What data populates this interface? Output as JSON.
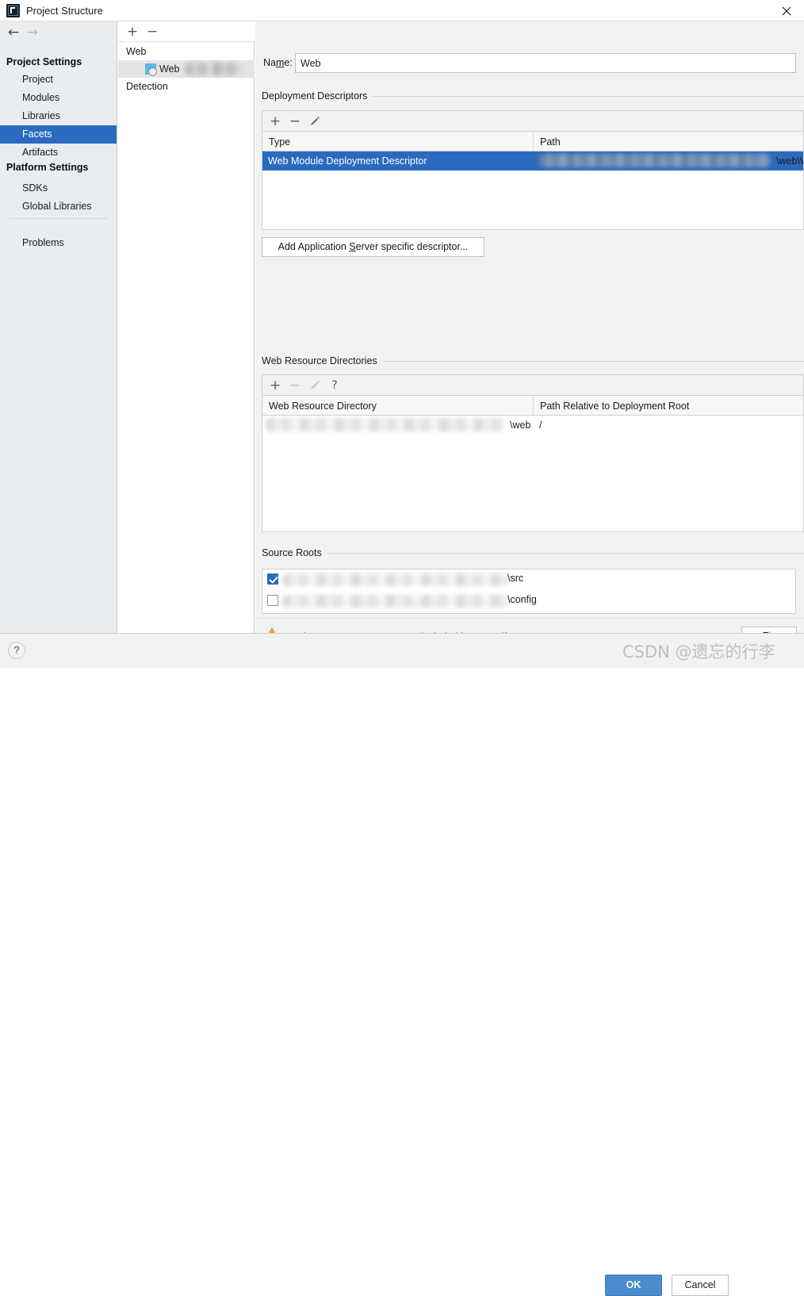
{
  "window": {
    "title": "Project Structure",
    "app_icon": "intellij-idea-icon",
    "close_icon": "close-icon"
  },
  "nav": {
    "back_icon": "arrow-left-icon",
    "forward_icon": "arrow-right-icon"
  },
  "sidebar": {
    "groups": [
      {
        "title": "Project Settings",
        "items": [
          {
            "label": "Project",
            "selected": false
          },
          {
            "label": "Modules",
            "selected": false
          },
          {
            "label": "Libraries",
            "selected": false
          },
          {
            "label": "Facets",
            "selected": true
          },
          {
            "label": "Artifacts",
            "selected": false
          }
        ]
      },
      {
        "title": "Platform Settings",
        "items": [
          {
            "label": "SDKs",
            "selected": false
          },
          {
            "label": "Global Libraries",
            "selected": false
          }
        ]
      }
    ],
    "problems_label": "Problems"
  },
  "facet_panel": {
    "toolbar": {
      "add": "+",
      "remove": "−"
    },
    "rows": [
      {
        "label": "Web",
        "indent": false,
        "icon": false,
        "selected": false,
        "redacted": false
      },
      {
        "label": "Web",
        "indent": true,
        "icon": true,
        "selected": true,
        "redacted": true
      },
      {
        "label": "Detection",
        "indent": false,
        "icon": false,
        "selected": false,
        "redacted": false
      }
    ]
  },
  "main": {
    "name_field": {
      "label": "Name:",
      "label_mnemonic": "m",
      "value": "Web",
      "placeholder": ""
    },
    "deployment_descriptors": {
      "title": "Deployment Descriptors",
      "toolbar": {
        "add": "+",
        "remove": "−",
        "edit": "pencil-icon"
      },
      "columns": [
        "Type",
        "Path"
      ],
      "rows": [
        {
          "type": "Web Module Deployment Descriptor",
          "path_redacted": true,
          "path_suffix": "\\web\\WE",
          "selected": true
        }
      ],
      "add_server_descriptor_button": "Add Application Server specific descriptor...",
      "add_server_descriptor_mnemonic": "S"
    },
    "web_resource_directories": {
      "title": "Web Resource Directories",
      "toolbar": {
        "add": "+",
        "remove": "−",
        "edit": "pencil-icon",
        "help": "?"
      },
      "columns": [
        "Web Resource Directory",
        "Path Relative to Deployment Root"
      ],
      "rows": [
        {
          "directory_redacted": true,
          "directory_suffix": "\\web",
          "relative_path": "/"
        }
      ]
    },
    "source_roots": {
      "title": "Source Roots",
      "rows": [
        {
          "checked": true,
          "path_redacted": true,
          "path_suffix": "\\src"
        },
        {
          "checked": false,
          "path_redacted": true,
          "path_suffix": "\\config"
        }
      ]
    },
    "warning": {
      "icon": "warning-triangle-icon",
      "text": "'Web' Facet resources are not included in any artifacts",
      "fix_button": "Fix",
      "fix_mnemonic": "F"
    }
  },
  "footer": {
    "help_button": "?",
    "ok_button": "OK",
    "cancel_button": "Cancel"
  },
  "watermark": {
    "text": "CSDN @遗忘的行李"
  },
  "colors": {
    "accent_blue": "#2a6bbf",
    "primary_button": "#4a8ccd",
    "sidebar_bg": "#e9edf0",
    "content_bg": "#f2f2f2",
    "warning_orange": "#f0a92e"
  }
}
